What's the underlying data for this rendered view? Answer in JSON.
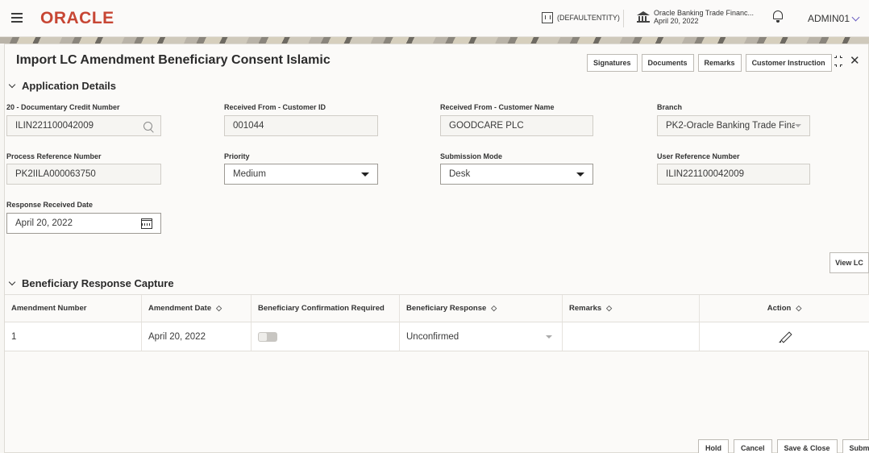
{
  "header": {
    "logo": "ORACLE",
    "entity": "(DEFAULTENTITY)",
    "bank_name": "Oracle Banking Trade Financ...",
    "bank_date": "April 20, 2022",
    "user": "ADMIN01"
  },
  "page": {
    "title": "Import LC Amendment Beneficiary Consent Islamic",
    "buttons": [
      "Signatures",
      "Documents",
      "Remarks",
      "Customer Instruction"
    ]
  },
  "application_details": {
    "section_title": "Application Details",
    "documentary_credit_number": {
      "label": "20 - Documentary Credit Number",
      "value": "ILIN221100042009"
    },
    "customer_id": {
      "label": "Received From - Customer ID",
      "value": "001044"
    },
    "customer_name": {
      "label": "Received From - Customer Name",
      "value": "GOODCARE PLC"
    },
    "branch": {
      "label": "Branch",
      "value": "PK2-Oracle Banking Trade Fina"
    },
    "process_reference": {
      "label": "Process Reference Number",
      "value": "PK2IILA000063750"
    },
    "priority": {
      "label": "Priority",
      "value": "Medium"
    },
    "submission_mode": {
      "label": "Submission Mode",
      "value": "Desk"
    },
    "user_reference": {
      "label": "User Reference Number",
      "value": "ILIN221100042009"
    },
    "response_date": {
      "label": "Response Received Date",
      "value": "April 20, 2022"
    }
  },
  "view_lc_label": "View LC",
  "beneficiary": {
    "section_title": "Beneficiary Response Capture",
    "columns": [
      "Amendment Number",
      "Amendment Date",
      "Beneficiary Confirmation Required",
      "Beneficiary Response",
      "Remarks",
      "Action"
    ],
    "rows": [
      {
        "amendment_number": "1",
        "amendment_date": "April 20, 2022",
        "confirmation_required": false,
        "response": "Unconfirmed",
        "remarks": ""
      }
    ]
  },
  "footer_buttons": [
    "Hold",
    "Cancel",
    "Save & Close",
    "Submit"
  ]
}
